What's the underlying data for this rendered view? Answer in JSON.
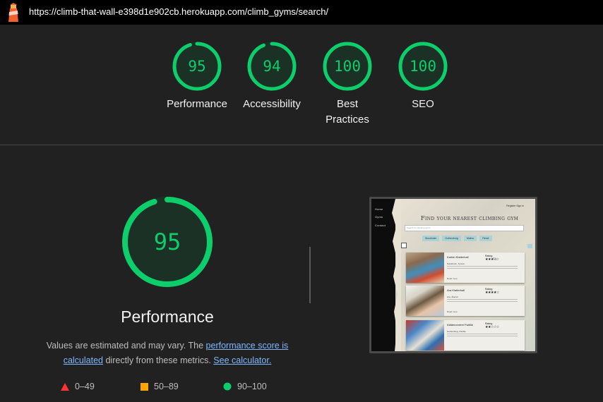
{
  "browser": {
    "url": "https://climb-that-wall-e398d1e902cb.herokuapp.com/climb_gyms/search/",
    "logo_icon": "lighthouse-icon"
  },
  "scores": [
    {
      "label": "Performance",
      "score": "95",
      "fraction": 0.95
    },
    {
      "label": "Accessibility",
      "score": "94",
      "fraction": 0.94
    },
    {
      "label": "Best\nPractices",
      "score": "100",
      "fraction": 1.0
    },
    {
      "label": "SEO",
      "score": "100",
      "fraction": 1.0
    }
  ],
  "main": {
    "score": "95",
    "fraction": 0.95,
    "title": "Performance",
    "desc_prefix": "Values are estimated and may vary. The ",
    "link_perf_score": "performance score is calculated",
    "desc_middle": " directly from these metrics. ",
    "link_calculator": "See calculator."
  },
  "legend": {
    "fail": "0–49",
    "average": "50–89",
    "pass": "90–100"
  },
  "colors": {
    "pass": "#0cce6b",
    "average": "#ffa400",
    "fail": "#ff4e42",
    "gauge_bg": "#1b3126",
    "page_bg": "#212121"
  },
  "screenshot": {
    "nav": [
      "Home",
      "Gyms",
      "Contact"
    ],
    "top_links": "Register   Sign in",
    "title": "Find your nearest climbing gym",
    "search_placeholder": "Search for climbing gyms",
    "chips": [
      "Stockholm",
      "Gothenburg",
      "Malmo",
      "Reset"
    ],
    "cards": [
      {
        "name": "Karbin Klatterhall",
        "rating_label": "Rating:",
        "stars": "★★★½☆",
        "location": "Stockholm, Tyresö",
        "more": "Read more"
      },
      {
        "name": "Ara Klatterhall",
        "rating_label": "Rating:",
        "stars": "★★★★☆",
        "location": "Ara, Åkersö",
        "more": "Read more"
      },
      {
        "name": "Klättercentret Partille",
        "rating_label": "Rating:",
        "stars": "★★☆☆☆",
        "location": "Gothenburg, Partille",
        "more": "Read more"
      }
    ]
  }
}
